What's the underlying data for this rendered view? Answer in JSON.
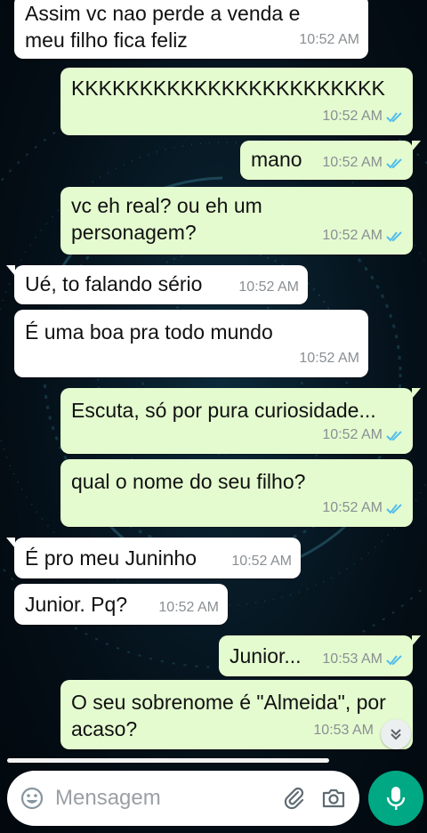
{
  "messages": [
    {
      "dir": "in",
      "text": "Assim vc nao perde a venda e\nmeu filho fica feliz",
      "time": "10:52 AM"
    },
    {
      "dir": "out",
      "text": "KKKKKKKKKKKKKKKKKKKKKKK",
      "time": "10:52 AM"
    },
    {
      "dir": "out",
      "text": "mano",
      "time": "10:52 AM"
    },
    {
      "dir": "out",
      "text": "vc eh real? ou eh um\npersonagem?",
      "time": "10:52 AM"
    },
    {
      "dir": "in",
      "text": "Ué, to falando sério",
      "time": "10:52 AM"
    },
    {
      "dir": "in",
      "text": "É uma boa pra todo mundo",
      "time": "10:52 AM"
    },
    {
      "dir": "out",
      "text": "Escuta, só por pura curiosidade...",
      "time": "10:52 AM"
    },
    {
      "dir": "out",
      "text": "qual o nome do seu filho?",
      "time": "10:52 AM"
    },
    {
      "dir": "in",
      "text": "É pro meu Juninho",
      "time": "10:52 AM"
    },
    {
      "dir": "in",
      "text": "Junior. Pq?",
      "time": "10:52 AM"
    },
    {
      "dir": "out",
      "text": "Junior...",
      "time": "10:53 AM"
    },
    {
      "dir": "out",
      "text": "O seu sobrenome é \"Almeida\", por\nacaso?",
      "time": "10:53 AM"
    }
  ],
  "composer": {
    "placeholder": "Mensagem",
    "icons": [
      "emoji-icon",
      "paperclip-icon",
      "camera-icon",
      "microphone-icon"
    ]
  },
  "icons": {
    "read_receipt": "double-check-icon",
    "scroll": "chevron-double-down-icon"
  },
  "colors": {
    "incoming_bubble": "#ffffff",
    "outgoing_bubble": "#e4fbcf",
    "read_tick": "#53bdeb",
    "mic_button": "#00a884",
    "timestamp": "#8a8f93"
  }
}
